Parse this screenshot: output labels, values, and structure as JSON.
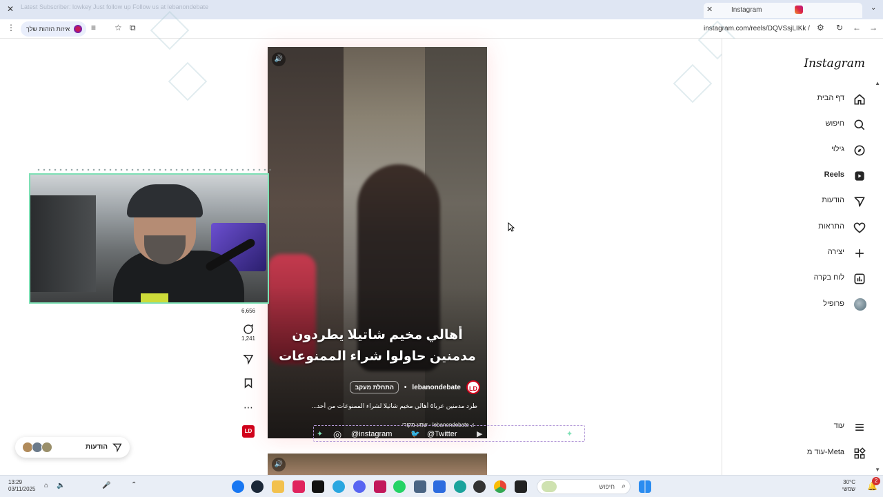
{
  "browser": {
    "tab_title": "Instagram",
    "url": "instagram.com/reels/DQVSsjLIKk /",
    "identity_label": "איזות הזהות שלך",
    "tabbar_blurred_text": "Latest Subscriber: lowkey Just follow up Follow us at lebanondebate"
  },
  "sidebar": {
    "logo": "Instagram",
    "items": [
      {
        "label": "דף הבית",
        "icon": "home-icon"
      },
      {
        "label": "חיפוש",
        "icon": "search-icon"
      },
      {
        "label": "גילוי",
        "icon": "compass-icon"
      },
      {
        "label": "Reels",
        "icon": "reels-icon"
      },
      {
        "label": "הודעות",
        "icon": "send-icon"
      },
      {
        "label": "התראות",
        "icon": "heart-icon"
      },
      {
        "label": "יצירה",
        "icon": "plus-icon"
      },
      {
        "label": "לוח בקרה",
        "icon": "chart-icon"
      },
      {
        "label": "פרופיל",
        "icon": "profile-avatar"
      }
    ],
    "bottom_items": [
      {
        "label": "עוד",
        "icon": "menu-icon"
      },
      {
        "label": "עוד מ-Meta",
        "icon": "grid-icon"
      }
    ]
  },
  "reel": {
    "caption_line1": "أهالي مخيم شاتيلا يطردون",
    "caption_line2": "مدمنين حاولوا شراء الممنوعات",
    "username": "lebanondebate",
    "follow_label": "התחלת מעקב",
    "avatar_text": "LD",
    "description": "طرد مدمنين عربا٥ أهالي مخيم شاتيلا لشراء الممنوعات من أحد...",
    "audio": "lebanondebate · שמע מקורי"
  },
  "actions": {
    "likes": "6,656",
    "comments": "1,241",
    "badge": "LD"
  },
  "social_overlay": {
    "instagram": "@instagram",
    "twitter": "@Twitter"
  },
  "messages_pill": {
    "label": "הודעות"
  },
  "taskbar": {
    "time": "13:29",
    "date": "03/11/2025",
    "search_label": "חיפוש",
    "weather_temp": "30°C",
    "weather_desc": "שמשי",
    "notif_count": "2"
  },
  "colors": {
    "accent_red": "#d0021b",
    "webcam_border": "#7ee0b5",
    "ig_gradient": "#dc2743"
  }
}
